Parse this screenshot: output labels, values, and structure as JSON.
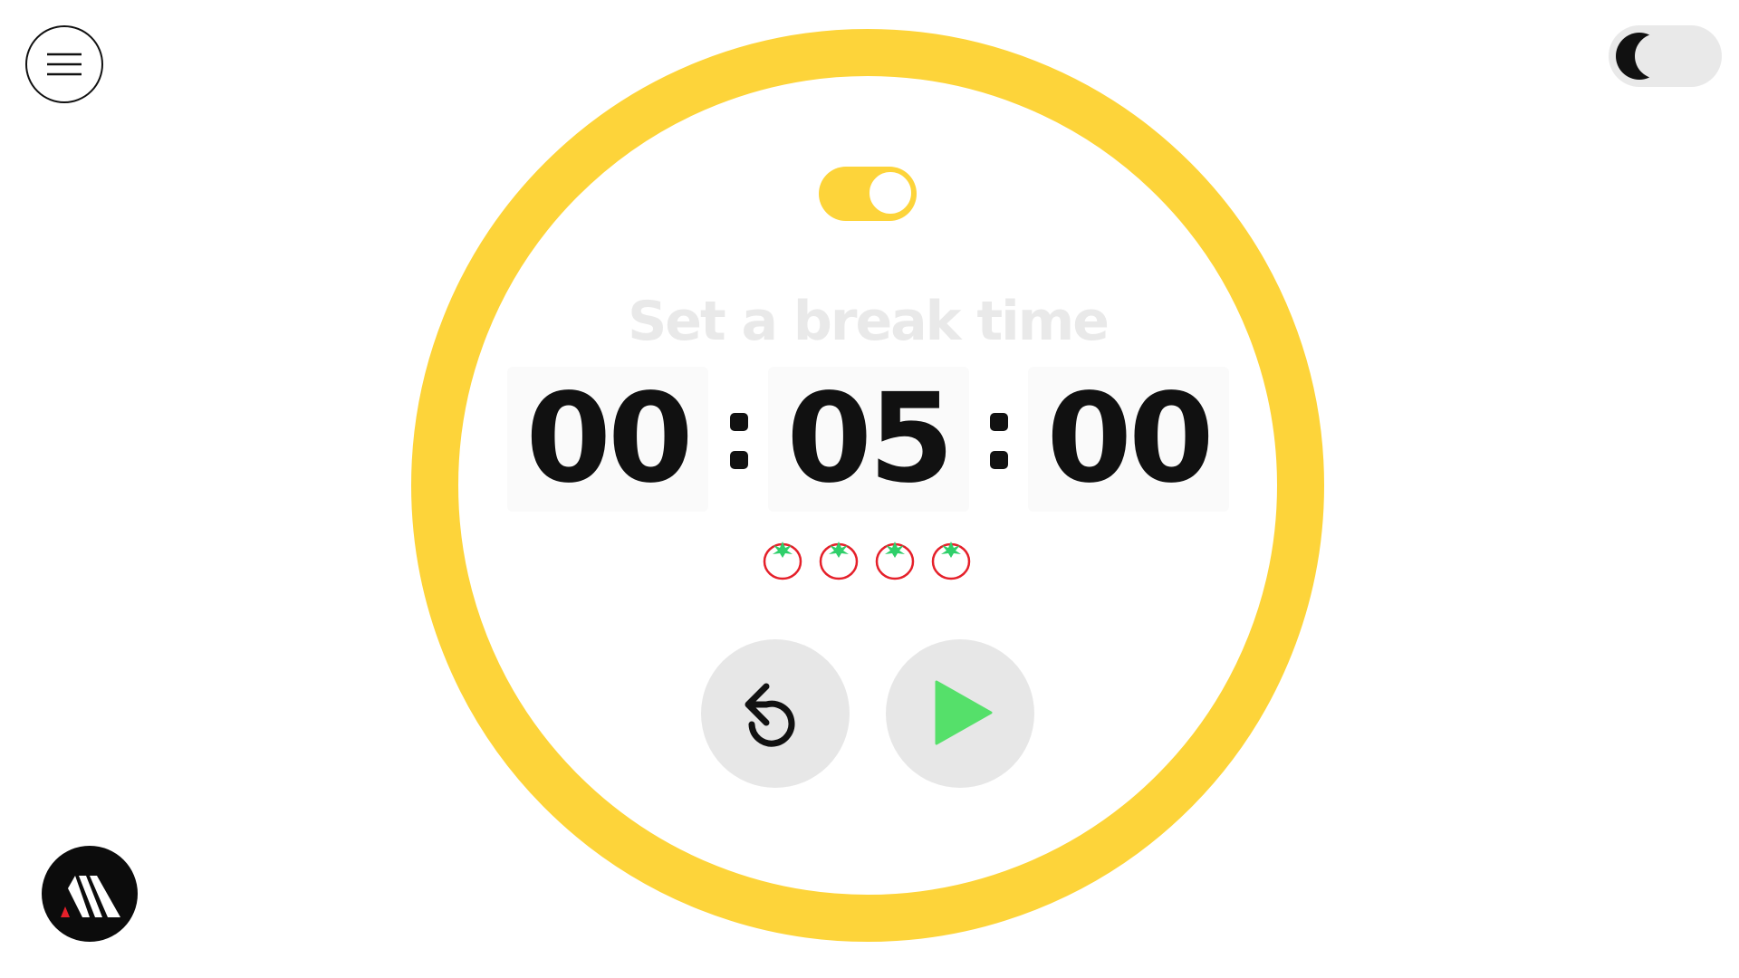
{
  "header": {
    "menu_icon": "hamburger-menu-icon",
    "theme_toggle_icon": "crescent-moon-icon"
  },
  "timer": {
    "mode_toggle_state": "on",
    "label": "Set a break time",
    "hours": "00",
    "minutes": "05",
    "seconds": "00",
    "separator": ":",
    "completed_pomodoros": 4,
    "pomodoro_icon": "tomato-icon"
  },
  "controls": {
    "reset_icon": "undo-arrow-icon",
    "play_icon": "play-icon"
  },
  "colors": {
    "ring": "#fdd43a",
    "toggle_accent": "#fdd43a",
    "play": "#55e06a",
    "tomato_outline": "#e5202a",
    "tomato_leaf": "#2fcf6a",
    "button_bg": "#e7e7e7",
    "label_text": "#e9e9e9"
  },
  "footer": {
    "logo_icon": "brand-logo-icon"
  }
}
